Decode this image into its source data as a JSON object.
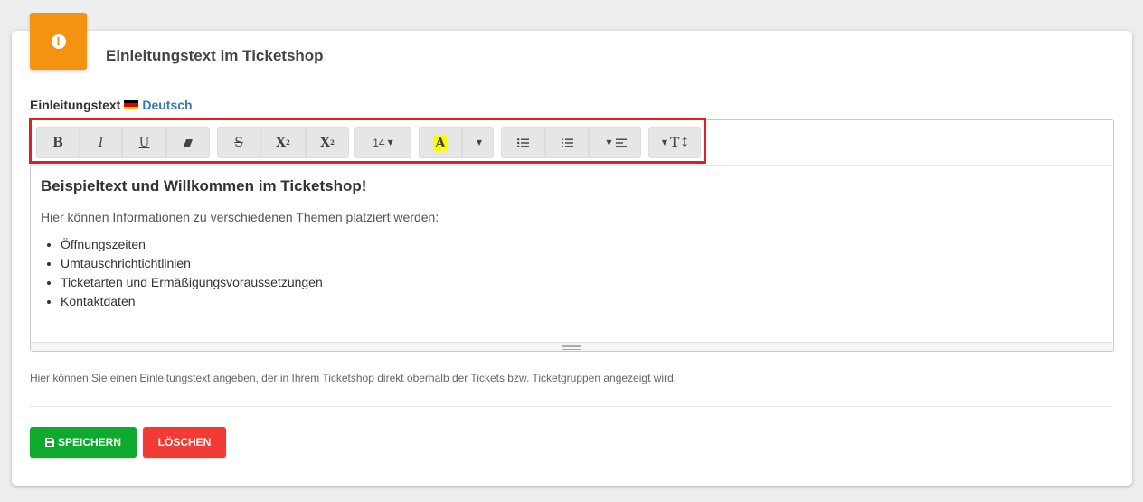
{
  "card": {
    "title": "Einleitungstext im Ticketshop",
    "icon": "exclamation-circle-icon",
    "accent_color": "#f59310"
  },
  "field": {
    "label": "Einleitungstext",
    "language_flag": "german-flag-icon",
    "language": "Deutsch"
  },
  "toolbar": {
    "bold": "B",
    "italic": "I",
    "underline": "U",
    "eraser": "eraser-icon",
    "strikethrough": "S",
    "superscript": "X",
    "subscript": "X",
    "font_size": "14",
    "color": "A",
    "color_highlight": "#ffff00",
    "unordered_list": "unordered-list-icon",
    "ordered_list": "ordered-list-icon",
    "align": "align-icon",
    "line_height": "T↕"
  },
  "content": {
    "heading": "Beispieltext und Willkommen im Ticketshop!",
    "intro_before": "Hier können ",
    "intro_link": "Informationen zu verschiedenen Themen",
    "intro_after": " platziert werden:",
    "list": [
      "Öffnungszeiten",
      "Umtauschrichtichtlinien",
      "Ticketarten und Ermäßigungsvoraussetzungen",
      "Kontaktdaten"
    ]
  },
  "help_text": "Hier können Sie einen Einleitungstext angeben, der in Ihrem Ticketshop direkt oberhalb der Tickets bzw. Ticketgruppen angezeigt wird.",
  "buttons": {
    "save": "SPEICHERN",
    "delete": "LÖSCHEN",
    "save_color": "#0daa2e",
    "delete_color": "#f33b35"
  }
}
